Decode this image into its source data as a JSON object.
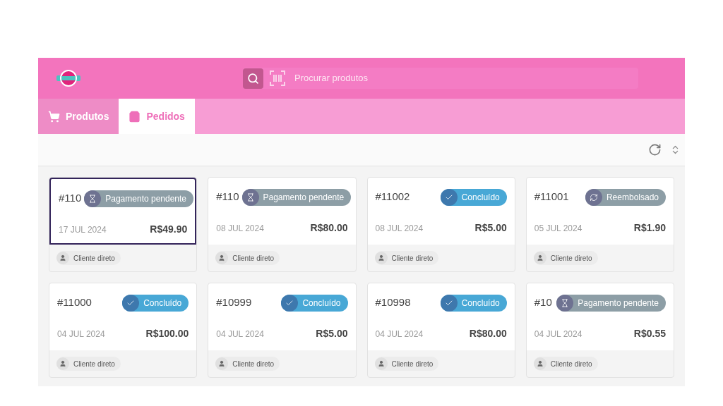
{
  "header": {
    "search": {
      "placeholder": "Procurar produtos"
    }
  },
  "tabs": [
    {
      "label": "Produtos",
      "selected": false
    },
    {
      "label": "Pedidos",
      "selected": true
    }
  ],
  "orders": [
    {
      "number": "#110",
      "status": {
        "kind": "pending",
        "label": "Pagamento pendente"
      },
      "date": "17 JUL 2024",
      "total": "R$49.90",
      "customer": "Cliente direto",
      "selected": true
    },
    {
      "number": "#110",
      "status": {
        "kind": "pending",
        "label": "Pagamento pendente"
      },
      "date": "08 JUL 2024",
      "total": "R$80.00",
      "customer": "Cliente direto",
      "selected": false
    },
    {
      "number": "#11002",
      "status": {
        "kind": "done",
        "label": "Concluído"
      },
      "date": "08 JUL 2024",
      "total": "R$5.00",
      "customer": "Cliente direto",
      "selected": false
    },
    {
      "number": "#11001",
      "status": {
        "kind": "refunded",
        "label": "Reembolsado"
      },
      "date": "05 JUL 2024",
      "total": "R$1.90",
      "customer": "Cliente direto",
      "selected": false
    },
    {
      "number": "#11000",
      "status": {
        "kind": "done",
        "label": "Concluído"
      },
      "date": "04 JUL 2024",
      "total": "R$100.00",
      "customer": "Cliente direto",
      "selected": false
    },
    {
      "number": "#10999",
      "status": {
        "kind": "done",
        "label": "Concluído"
      },
      "date": "04 JUL 2024",
      "total": "R$5.00",
      "customer": "Cliente direto",
      "selected": false
    },
    {
      "number": "#10998",
      "status": {
        "kind": "done",
        "label": "Concluído"
      },
      "date": "04 JUL 2024",
      "total": "R$80.00",
      "customer": "Cliente direto",
      "selected": false
    },
    {
      "number": "#10",
      "status": {
        "kind": "pending",
        "label": "Pagamento pendente"
      },
      "date": "04 JUL 2024",
      "total": "R$0.55",
      "customer": "Cliente direto",
      "selected": false
    }
  ]
}
